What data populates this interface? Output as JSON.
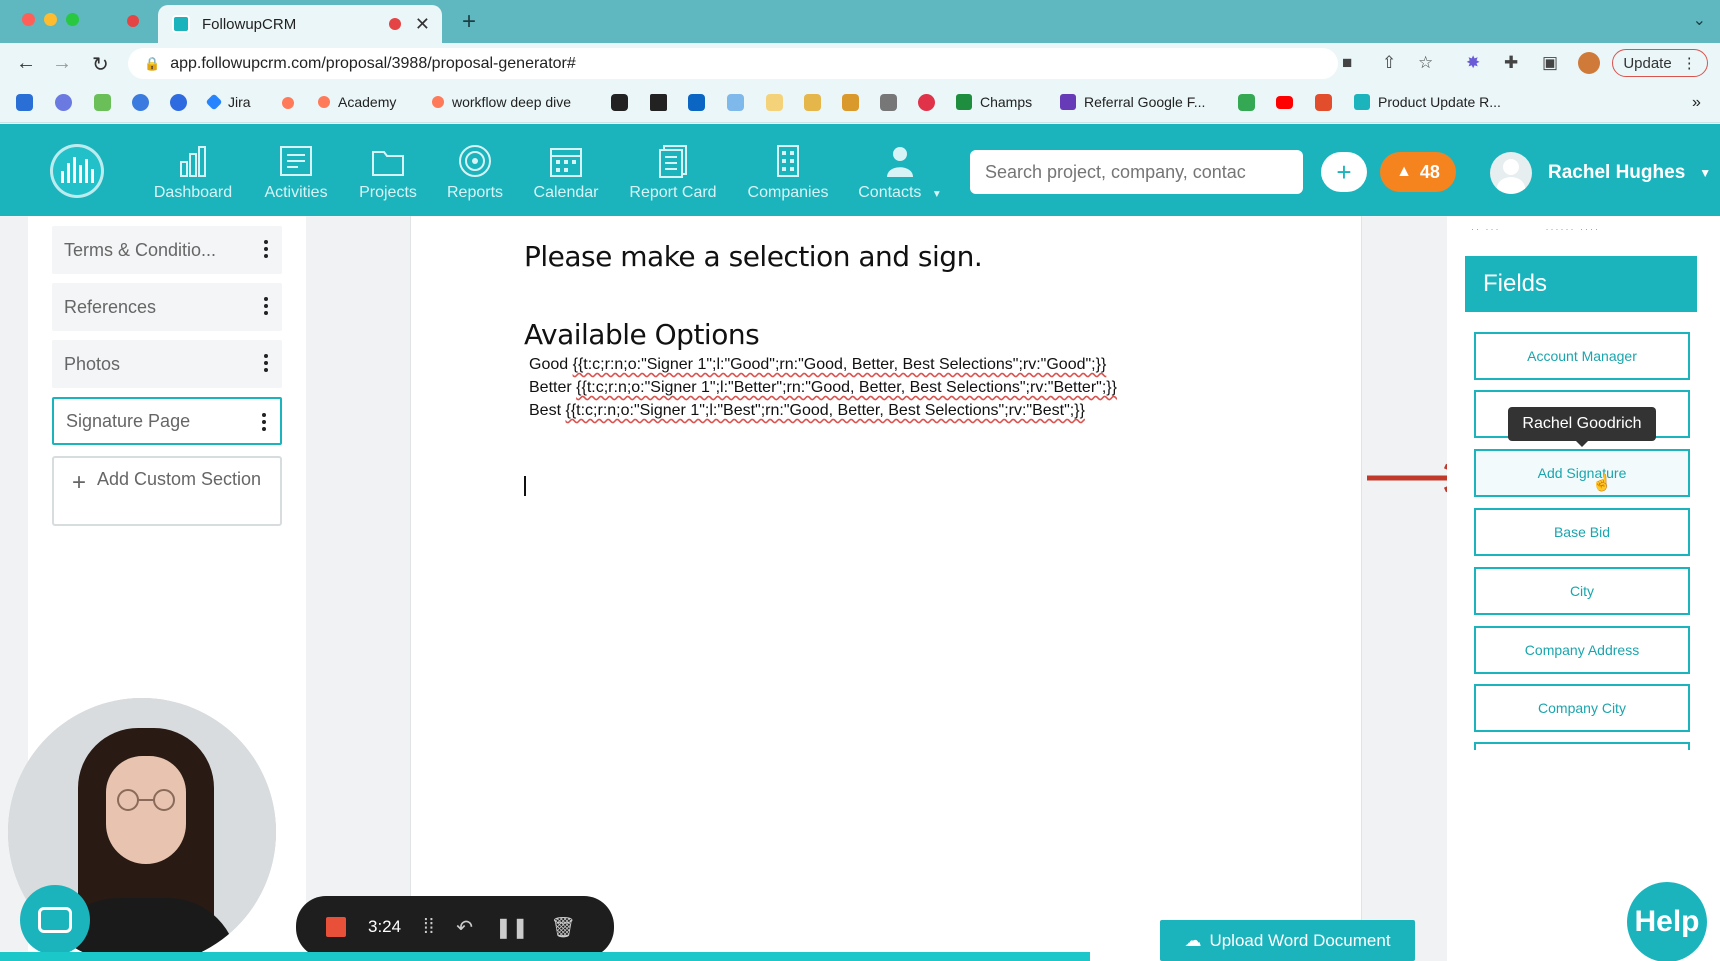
{
  "browser": {
    "tab_title": "FollowupCRM",
    "url": "app.followupcrm.com/proposal/3988/proposal-generator#",
    "update_label": "Update",
    "bookmarks": [
      "Jira",
      "Academy",
      "workflow deep dive",
      "Champs",
      "Referral Google F...",
      "Product Update R..."
    ]
  },
  "nav": {
    "items": [
      {
        "label": "Dashboard",
        "icon": "bar-chart-icon"
      },
      {
        "label": "Activities",
        "icon": "activities-icon"
      },
      {
        "label": "Projects",
        "icon": "folder-icon"
      },
      {
        "label": "Reports",
        "icon": "target-icon"
      },
      {
        "label": "Calendar",
        "icon": "calendar-icon"
      },
      {
        "label": "Report Card",
        "icon": "report-card-icon"
      },
      {
        "label": "Companies",
        "icon": "building-icon"
      },
      {
        "label": "Contacts",
        "icon": "person-icon"
      }
    ],
    "search_placeholder": "Search project, company, contac",
    "notification_count": "48",
    "user_name": "Rachel Hughes"
  },
  "sections": {
    "items": [
      "Terms & Conditio...",
      "References",
      "Photos",
      "Signature Page"
    ],
    "active": "Signature Page",
    "add_custom_label": "Add Custom Section"
  },
  "document": {
    "heading": "Please make a selection and sign.",
    "subheading": "Available Options",
    "options": [
      {
        "name": "Good",
        "token": "{{t:c;r:n;o:\"Signer 1\";l:\"Good\";rn:\"Good, Better, Best Selections\";rv:\"Good\";}}"
      },
      {
        "name": "Better",
        "token": "{{t:c;r:n;o:\"Signer 1\";l:\"Better\";rn:\"Good, Better, Best Selections\";rv:\"Better\";}}"
      },
      {
        "name": "Best",
        "token": "{{t:c;r:n;o:\"Signer 1\";l:\"Best\";rn:\"Good, Better, Best Selections\";rv:\"Best\";}}"
      }
    ]
  },
  "fields": {
    "title": "Fields",
    "items": [
      "Account Manager",
      "",
      "Add Signature",
      "Base Bid",
      "City",
      "Company Address",
      "Company City"
    ],
    "tooltip": "Rachel Goodrich"
  },
  "recorder": {
    "time": "3:24"
  },
  "upload_label": "Upload Word Document",
  "help_label": "Help",
  "colors": {
    "brand": "#1bb4bd",
    "notification": "#f5841f",
    "arrow": "#c0392b"
  }
}
